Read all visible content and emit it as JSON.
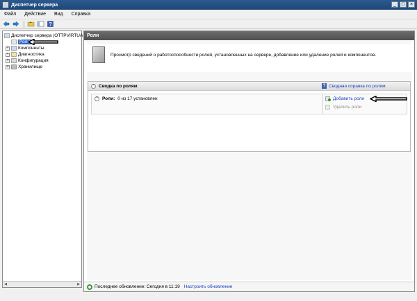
{
  "window": {
    "title": "Диспетчер сервера"
  },
  "menu": {
    "items": [
      "Файл",
      "Действие",
      "Вид",
      "Справка"
    ]
  },
  "toolbar": {
    "buttons": [
      "back-icon",
      "forward-icon",
      "up-folder-icon",
      "show-hide-tree-icon",
      "help-icon"
    ]
  },
  "tree": {
    "root": "Диспетчер сервера (OTTPVIRTUA",
    "items": [
      {
        "label": "Роли",
        "selected": true
      },
      {
        "label": "Компоненты"
      },
      {
        "label": "Диагностика"
      },
      {
        "label": "Конфигурация"
      },
      {
        "label": "Хранилище"
      }
    ]
  },
  "content": {
    "header": "Роли",
    "intro": "Просмотр сведений о работоспособности ролей, установленных на сервере, добавление или удаление ролей и компонентов.",
    "summary": {
      "title": "Сводка по ролям",
      "help_link": "Сводная справка по ролям",
      "roles_label": "Роли:",
      "roles_value": "0 из 17 установлен",
      "actions": {
        "add": "Добавить роли",
        "remove": "Удалить роли"
      }
    },
    "status": {
      "last_update": "Последнее обновление: Сегодня в 11:19",
      "configure_link": "Настроить обновление"
    }
  },
  "colors": {
    "titlebar": "#1d4676",
    "selection": "#3169c6",
    "link": "#1a3fbf",
    "header_gray": "#5a5a5a"
  }
}
